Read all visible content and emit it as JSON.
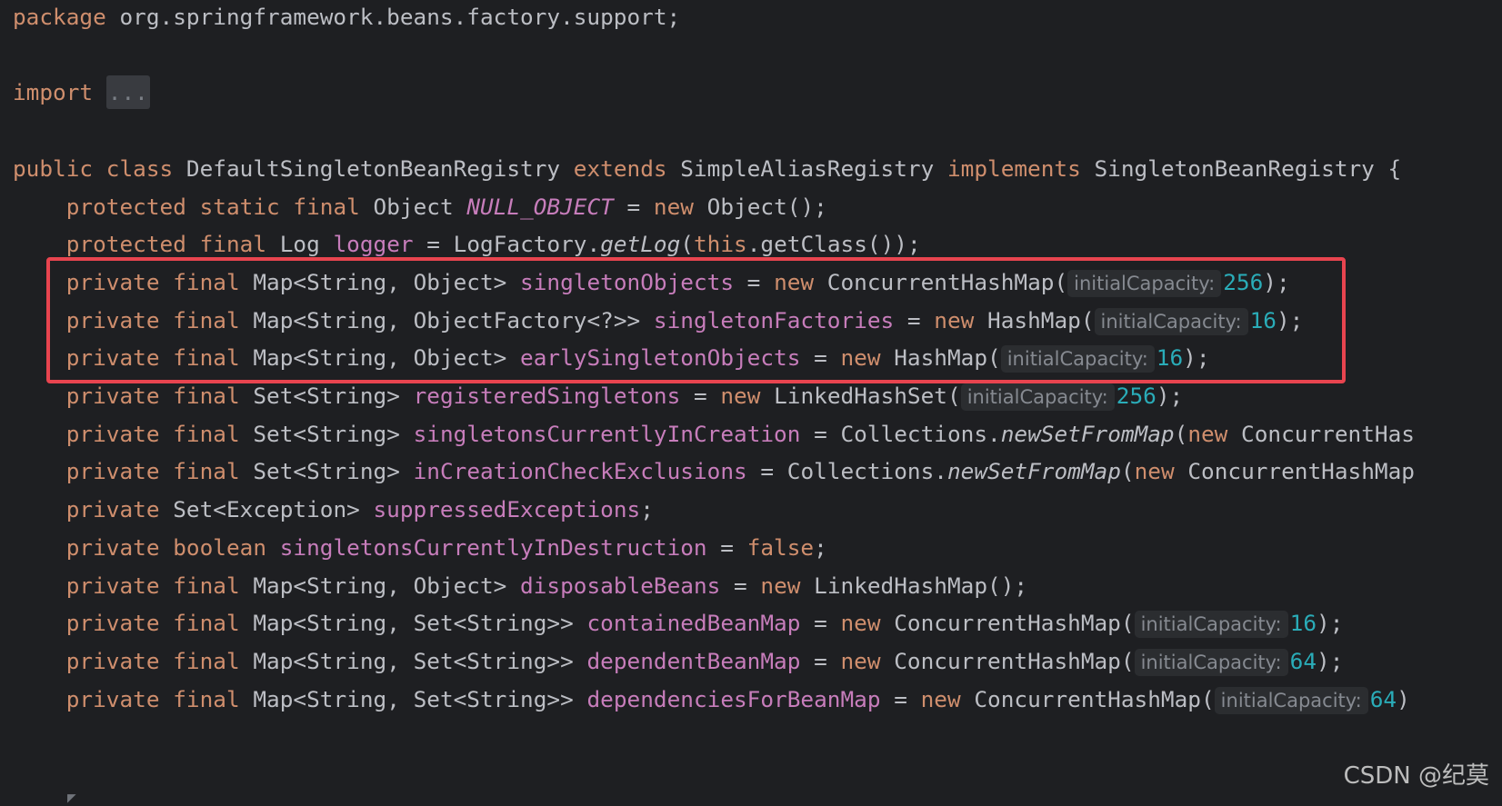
{
  "editor": {
    "lines": [
      [
        [
          "kw",
          "package"
        ],
        [
          "plain",
          " org.springframework.beans.factory.support;"
        ]
      ],
      [],
      [
        [
          "kw",
          "import"
        ],
        [
          "plain",
          " "
        ],
        [
          "fold",
          "..."
        ]
      ],
      [],
      [
        [
          "kw",
          "public"
        ],
        [
          "plain",
          " "
        ],
        [
          "kw",
          "class"
        ],
        [
          "plain",
          " DefaultSingletonBeanRegistry "
        ],
        [
          "kw",
          "extends"
        ],
        [
          "plain",
          " SimpleAliasRegistry "
        ],
        [
          "kw",
          "implements"
        ],
        [
          "plain",
          " SingletonBeanRegistry {"
        ]
      ],
      [
        [
          "plain",
          "    "
        ],
        [
          "kw",
          "protected"
        ],
        [
          "plain",
          " "
        ],
        [
          "kw",
          "static"
        ],
        [
          "plain",
          " "
        ],
        [
          "kw",
          "final"
        ],
        [
          "plain",
          " Object "
        ],
        [
          "static",
          "NULL_OBJECT"
        ],
        [
          "plain",
          " = "
        ],
        [
          "kw",
          "new"
        ],
        [
          "plain",
          " Object();"
        ]
      ],
      [
        [
          "plain",
          "    "
        ],
        [
          "kw",
          "protected"
        ],
        [
          "plain",
          " "
        ],
        [
          "kw",
          "final"
        ],
        [
          "plain",
          " Log "
        ],
        [
          "field",
          "logger"
        ],
        [
          "plain",
          " = LogFactory."
        ],
        [
          "fn",
          "getLog"
        ],
        [
          "plain",
          "("
        ],
        [
          "kw",
          "this"
        ],
        [
          "plain",
          ".getClass());"
        ]
      ],
      [
        [
          "plain",
          "    "
        ],
        [
          "kw",
          "private"
        ],
        [
          "plain",
          " "
        ],
        [
          "kw",
          "final"
        ],
        [
          "plain",
          " Map<String, Object> "
        ],
        [
          "field",
          "singletonObjects"
        ],
        [
          "plain",
          " = "
        ],
        [
          "kw",
          "new"
        ],
        [
          "plain",
          " ConcurrentHashMap("
        ],
        [
          "hint",
          "initialCapacity:"
        ],
        [
          "num",
          "256"
        ],
        [
          "plain",
          ");"
        ]
      ],
      [
        [
          "plain",
          "    "
        ],
        [
          "kw",
          "private"
        ],
        [
          "plain",
          " "
        ],
        [
          "kw",
          "final"
        ],
        [
          "plain",
          " Map<String, ObjectFactory<?>> "
        ],
        [
          "field",
          "singletonFactories"
        ],
        [
          "plain",
          " = "
        ],
        [
          "kw",
          "new"
        ],
        [
          "plain",
          " HashMap("
        ],
        [
          "hint",
          "initialCapacity:"
        ],
        [
          "num",
          "16"
        ],
        [
          "plain",
          ");"
        ]
      ],
      [
        [
          "plain",
          "    "
        ],
        [
          "kw",
          "private"
        ],
        [
          "plain",
          " "
        ],
        [
          "kw",
          "final"
        ],
        [
          "plain",
          " Map<String, Object> "
        ],
        [
          "field",
          "earlySingletonObjects"
        ],
        [
          "plain",
          " = "
        ],
        [
          "kw",
          "new"
        ],
        [
          "plain",
          " HashMap("
        ],
        [
          "hint",
          "initialCapacity:"
        ],
        [
          "num",
          "16"
        ],
        [
          "plain",
          ");"
        ]
      ],
      [
        [
          "plain",
          "    "
        ],
        [
          "kw",
          "private"
        ],
        [
          "plain",
          " "
        ],
        [
          "kw",
          "final"
        ],
        [
          "plain",
          " Set<String> "
        ],
        [
          "field",
          "registeredSingletons"
        ],
        [
          "plain",
          " = "
        ],
        [
          "kw",
          "new"
        ],
        [
          "plain",
          " LinkedHashSet("
        ],
        [
          "hint",
          "initialCapacity:"
        ],
        [
          "num",
          "256"
        ],
        [
          "plain",
          ");"
        ]
      ],
      [
        [
          "plain",
          "    "
        ],
        [
          "kw",
          "private"
        ],
        [
          "plain",
          " "
        ],
        [
          "kw",
          "final"
        ],
        [
          "plain",
          " Set<String> "
        ],
        [
          "field",
          "singletonsCurrentlyInCreation"
        ],
        [
          "plain",
          " = Collections."
        ],
        [
          "fn",
          "newSetFromMap"
        ],
        [
          "plain",
          "("
        ],
        [
          "kw",
          "new"
        ],
        [
          "plain",
          " ConcurrentHas"
        ]
      ],
      [
        [
          "plain",
          "    "
        ],
        [
          "kw",
          "private"
        ],
        [
          "plain",
          " "
        ],
        [
          "kw",
          "final"
        ],
        [
          "plain",
          " Set<String> "
        ],
        [
          "field",
          "inCreationCheckExclusions"
        ],
        [
          "plain",
          " = Collections."
        ],
        [
          "fn",
          "newSetFromMap"
        ],
        [
          "plain",
          "("
        ],
        [
          "kw",
          "new"
        ],
        [
          "plain",
          " ConcurrentHashMap"
        ]
      ],
      [
        [
          "plain",
          "    "
        ],
        [
          "kw",
          "private"
        ],
        [
          "plain",
          " Set<Exception> "
        ],
        [
          "field",
          "suppressedExceptions"
        ],
        [
          "plain",
          ";"
        ]
      ],
      [
        [
          "plain",
          "    "
        ],
        [
          "kw",
          "private"
        ],
        [
          "plain",
          " "
        ],
        [
          "kw",
          "boolean"
        ],
        [
          "plain",
          " "
        ],
        [
          "field",
          "singletonsCurrentlyInDestruction"
        ],
        [
          "plain",
          " = "
        ],
        [
          "kw",
          "false"
        ],
        [
          "plain",
          ";"
        ]
      ],
      [
        [
          "plain",
          "    "
        ],
        [
          "kw",
          "private"
        ],
        [
          "plain",
          " "
        ],
        [
          "kw",
          "final"
        ],
        [
          "plain",
          " Map<String, Object> "
        ],
        [
          "field",
          "disposableBeans"
        ],
        [
          "plain",
          " = "
        ],
        [
          "kw",
          "new"
        ],
        [
          "plain",
          " LinkedHashMap();"
        ]
      ],
      [
        [
          "plain",
          "    "
        ],
        [
          "kw",
          "private"
        ],
        [
          "plain",
          " "
        ],
        [
          "kw",
          "final"
        ],
        [
          "plain",
          " Map<String, Set<String>> "
        ],
        [
          "field",
          "containedBeanMap"
        ],
        [
          "plain",
          " = "
        ],
        [
          "kw",
          "new"
        ],
        [
          "plain",
          " ConcurrentHashMap("
        ],
        [
          "hint",
          "initialCapacity:"
        ],
        [
          "num",
          "16"
        ],
        [
          "plain",
          ");"
        ]
      ],
      [
        [
          "plain",
          "    "
        ],
        [
          "kw",
          "private"
        ],
        [
          "plain",
          " "
        ],
        [
          "kw",
          "final"
        ],
        [
          "plain",
          " Map<String, Set<String>> "
        ],
        [
          "field",
          "dependentBeanMap"
        ],
        [
          "plain",
          " = "
        ],
        [
          "kw",
          "new"
        ],
        [
          "plain",
          " ConcurrentHashMap("
        ],
        [
          "hint",
          "initialCapacity:"
        ],
        [
          "num",
          "64"
        ],
        [
          "plain",
          ");"
        ]
      ],
      [
        [
          "plain",
          "    "
        ],
        [
          "kw",
          "private"
        ],
        [
          "plain",
          " "
        ],
        [
          "kw",
          "final"
        ],
        [
          "plain",
          " Map<String, Set<String>> "
        ],
        [
          "field",
          "dependenciesForBeanMap"
        ],
        [
          "plain",
          " = "
        ],
        [
          "kw",
          "new"
        ],
        [
          "plain",
          " ConcurrentHashMap("
        ],
        [
          "hint",
          "initialCapacity:"
        ],
        [
          "num",
          "64"
        ],
        [
          "plain",
          ")"
        ]
      ]
    ]
  },
  "watermark": "CSDN @纪莫",
  "colors": {
    "background": "#1e1f22",
    "keyword": "#cf8e6d",
    "field": "#c77dbb",
    "number": "#2aacb8",
    "text": "#bcbec4",
    "inlay_hint": "#868a91",
    "highlight_box": "#e8444f"
  }
}
